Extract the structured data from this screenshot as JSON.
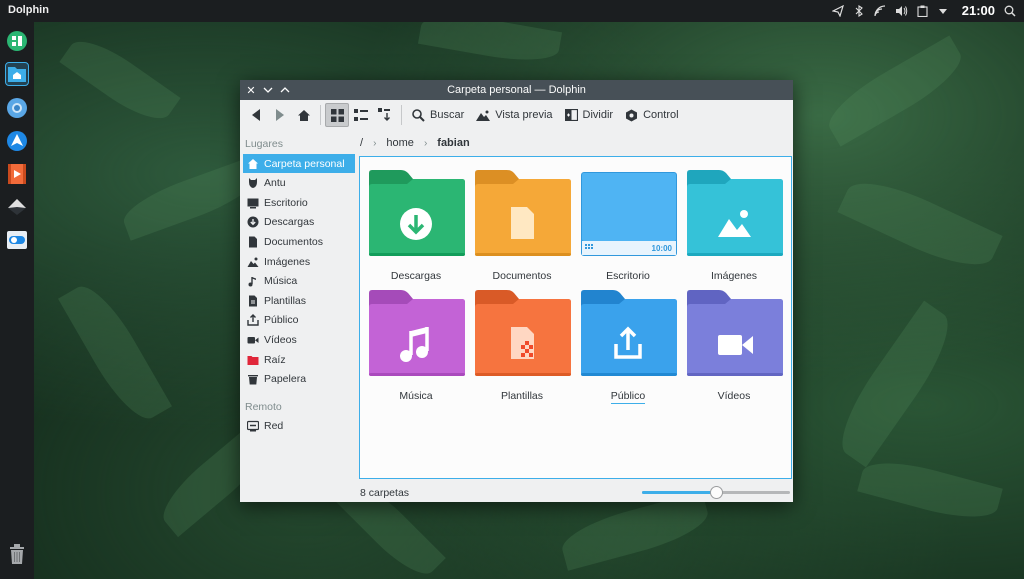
{
  "top_panel": {
    "app_title": "Dolphin",
    "clock": "21:00",
    "tray_icons": [
      "telegram-icon",
      "bluetooth-icon",
      "network-icon",
      "volume-icon",
      "clipboard-icon",
      "chevron-down-icon",
      "search-icon"
    ]
  },
  "dock": {
    "items": [
      "app-grid-icon",
      "dolphin-icon",
      "browser-icon",
      "kdeconnect-icon",
      "media-player-icon",
      "terminal-icon",
      "toggle-icon"
    ],
    "trash_icon": "trash-icon"
  },
  "window": {
    "title": "Carpeta personal — Dolphin",
    "toolbar": {
      "search": "Buscar",
      "preview": "Vista previa",
      "split": "Dividir",
      "control": "Control"
    },
    "breadcrumb": {
      "root": "/",
      "home": "home",
      "current": "fabian"
    },
    "places": {
      "header": "Lugares",
      "items": [
        {
          "label": "Carpeta personal",
          "icon": "home-icon"
        },
        {
          "label": "Antu",
          "icon": "github-icon"
        },
        {
          "label": "Escritorio",
          "icon": "desktop-icon"
        },
        {
          "label": "Descargas",
          "icon": "download-icon"
        },
        {
          "label": "Documentos",
          "icon": "document-icon"
        },
        {
          "label": "Imágenes",
          "icon": "image-icon"
        },
        {
          "label": "Música",
          "icon": "music-icon"
        },
        {
          "label": "Plantillas",
          "icon": "template-icon"
        },
        {
          "label": "Público",
          "icon": "share-icon"
        },
        {
          "label": "Vídeos",
          "icon": "video-icon"
        },
        {
          "label": "Raíz",
          "icon": "root-folder-icon"
        },
        {
          "label": "Papelera",
          "icon": "trash-icon"
        }
      ],
      "remote_header": "Remoto",
      "remote_items": [
        {
          "label": "Red",
          "icon": "network-drive-icon"
        }
      ]
    },
    "folders": [
      {
        "label": "Descargas",
        "color": "#2bb673",
        "tab": "#1f9a5c",
        "glyph": "download"
      },
      {
        "label": "Documentos",
        "color": "#f5a838",
        "tab": "#dc8f24",
        "glyph": "document"
      },
      {
        "label": "Escritorio",
        "color": "#4fb4f3",
        "tab": "#3198dc",
        "glyph": "desktop",
        "taskbar_clock": "10:00"
      },
      {
        "label": "Imágenes",
        "color": "#35c2d8",
        "tab": "#1fa6bd",
        "glyph": "image"
      },
      {
        "label": "Música",
        "color": "#c363d6",
        "tab": "#a54bb9",
        "glyph": "music"
      },
      {
        "label": "Plantillas",
        "color": "#f6743f",
        "tab": "#d95a27",
        "glyph": "template"
      },
      {
        "label": "Público",
        "color": "#3aa2ec",
        "tab": "#2284cf",
        "glyph": "share"
      },
      {
        "label": "Vídeos",
        "color": "#7b7fdb",
        "tab": "#6064c2",
        "glyph": "video"
      }
    ],
    "status": "8 carpetas",
    "zoom_level": 0.5
  }
}
